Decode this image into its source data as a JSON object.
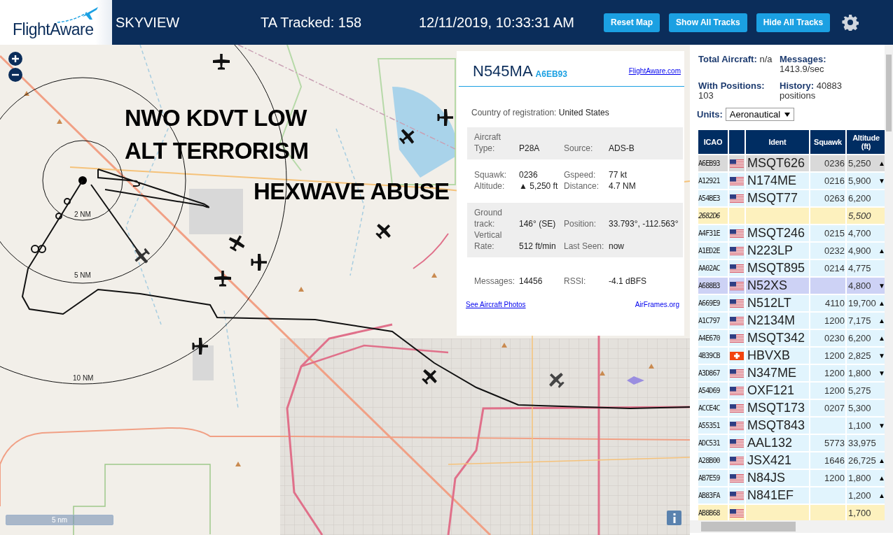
{
  "header": {
    "logo": "FlightAware",
    "title": "SKYVIEW",
    "tracked": "TA Tracked: 158",
    "datetime": "12/11/2019, 10:33:31 AM",
    "buttons": [
      "Reset Map",
      "Show All Tracks",
      "Hide All Tracks"
    ]
  },
  "map": {
    "annotations": [
      "NWO KDVT LOW",
      "ALT TERRORISM",
      "HEXWAVE ABUSE"
    ],
    "range_labels": [
      "2 NM",
      "5 NM",
      "10 NM"
    ],
    "scale": "5 nm"
  },
  "info": {
    "registration": "N545MA",
    "hex": "A6EB93",
    "link": "FlightAware.com",
    "country_label": "Country of registration:",
    "country": "United States",
    "sections": [
      {
        "shaded": true,
        "fields": [
          {
            "label": "Aircraft Type:",
            "value": "P28A"
          },
          {
            "label": "Source:",
            "value": "ADS-B"
          }
        ]
      },
      {
        "shaded": false,
        "fields": [
          {
            "label": "Squawk:",
            "value": "0236"
          },
          {
            "label": "Gspeed:",
            "value": "77 kt"
          },
          {
            "label": "Altitude:",
            "value": "▲ 5,250 ft"
          },
          {
            "label": "Distance:",
            "value": "4.7 NM"
          }
        ]
      },
      {
        "shaded": true,
        "fields": [
          {
            "label": "Ground track:",
            "value": "146° (SE)"
          },
          {
            "label": "Position:",
            "value": "33.793°, -112.563°"
          },
          {
            "label": "Vertical Rate:",
            "value": "512 ft/min"
          },
          {
            "label": "Last Seen:",
            "value": "now"
          }
        ]
      },
      {
        "shaded": false,
        "fields": [
          {
            "label": "Messages:",
            "value": "14456"
          },
          {
            "label": "RSSI:",
            "value": "-4.1 dBFS"
          }
        ]
      }
    ],
    "photos_link": "See Aircraft Photos",
    "airframes_link": "AirFrames.org"
  },
  "stats": [
    "**Total Aircraft:** n/a",
    "**Messages:** 1413.9/sec",
    "**With Positions:** 103",
    "**History:** 40883 positions"
  ],
  "units": {
    "label": "Units:",
    "value": "Aeronautical"
  },
  "table": {
    "columns": [
      "ICAO",
      "Ident",
      "Squawk",
      "Altitude (ft)"
    ],
    "rows": [
      {
        "icao": "A6EB93",
        "ident": "MSQT626",
        "squawk": "0236",
        "altitude": "5,250",
        "trend": "▲",
        "kind": "normal",
        "selected": true
      },
      {
        "icao": "A12921",
        "ident": "N174ME",
        "squawk": "0216",
        "altitude": "5,900",
        "trend": "▼",
        "kind": "normal",
        "selected": false
      },
      {
        "icao": "A54BE3",
        "ident": "MSQT77",
        "squawk": "0263",
        "altitude": "6,200",
        "kind": "normal",
        "selected": false
      },
      {
        "icao": "2682D6",
        "altitude": "5,500",
        "kind": "stale",
        "selected": false
      },
      {
        "icao": "A4F31E",
        "ident": "MSQT246",
        "squawk": "0215",
        "altitude": "4,700",
        "kind": "normal",
        "selected": false
      },
      {
        "icao": "A1ED2E",
        "ident": "N223LP",
        "squawk": "0232",
        "altitude": "4,900",
        "trend": "▲",
        "kind": "normal",
        "selected": false
      },
      {
        "icao": "AA02AC",
        "ident": "MSQT895",
        "squawk": "0214",
        "altitude": "4,775",
        "kind": "normal",
        "selected": false
      },
      {
        "icao": "A688B3",
        "ident": "N52XS",
        "altitude": "4,800",
        "trend": "▼",
        "kind": "marked",
        "selected": false
      },
      {
        "icao": "A669E9",
        "ident": "N512LT",
        "squawk": "4110",
        "altitude": "19,700",
        "trend": "▲",
        "kind": "normal",
        "selected": false
      },
      {
        "icao": "A1C797",
        "ident": "N2134M",
        "squawk": "1200",
        "altitude": "7,175",
        "trend": "▲",
        "kind": "normal",
        "selected": false
      },
      {
        "icao": "A4E670",
        "ident": "MSQT342",
        "squawk": "0230",
        "altitude": "6,200",
        "trend": "▲",
        "kind": "normal",
        "selected": false
      },
      {
        "icao": "4B39CB",
        "ident": "HBVXB",
        "squawk": "1200",
        "altitude": "2,825",
        "trend": "▼",
        "kind": "normal",
        "selected": false
      },
      {
        "icao": "A3D867",
        "ident": "N347ME",
        "squawk": "1200",
        "altitude": "1,800",
        "trend": "▼",
        "kind": "normal",
        "selected": false
      },
      {
        "icao": "A54D69",
        "ident": "OXF121",
        "squawk": "1200",
        "altitude": "5,275",
        "kind": "normal",
        "selected": false
      },
      {
        "icao": "ACCE4C",
        "ident": "MSQT173",
        "squawk": "0207",
        "altitude": "5,300",
        "kind": "normal",
        "selected": false
      },
      {
        "icao": "A55351",
        "ident": "MSQT843",
        "altitude": "1,100",
        "trend": "▼",
        "kind": "normal",
        "selected": false
      },
      {
        "icao": "ADC531",
        "ident": "AAL132",
        "squawk": "5773",
        "altitude": "33,975",
        "kind": "normal",
        "selected": false
      },
      {
        "icao": "A28B00",
        "ident": "JSX421",
        "squawk": "1646",
        "altitude": "26,725",
        "trend": "▲",
        "kind": "normal",
        "selected": false
      },
      {
        "icao": "AB7E59",
        "ident": "N84JS",
        "squawk": "1200",
        "altitude": "1,800",
        "trend": "▲",
        "kind": "normal",
        "selected": false
      },
      {
        "icao": "AB83FA",
        "ident": "N841EF",
        "altitude": "1,200",
        "trend": "▲",
        "kind": "normal",
        "selected": false
      },
      {
        "icao": "AB8B68",
        "altitude": "1,700",
        "kind": "nocallsign",
        "selected": false
      }
    ]
  }
}
